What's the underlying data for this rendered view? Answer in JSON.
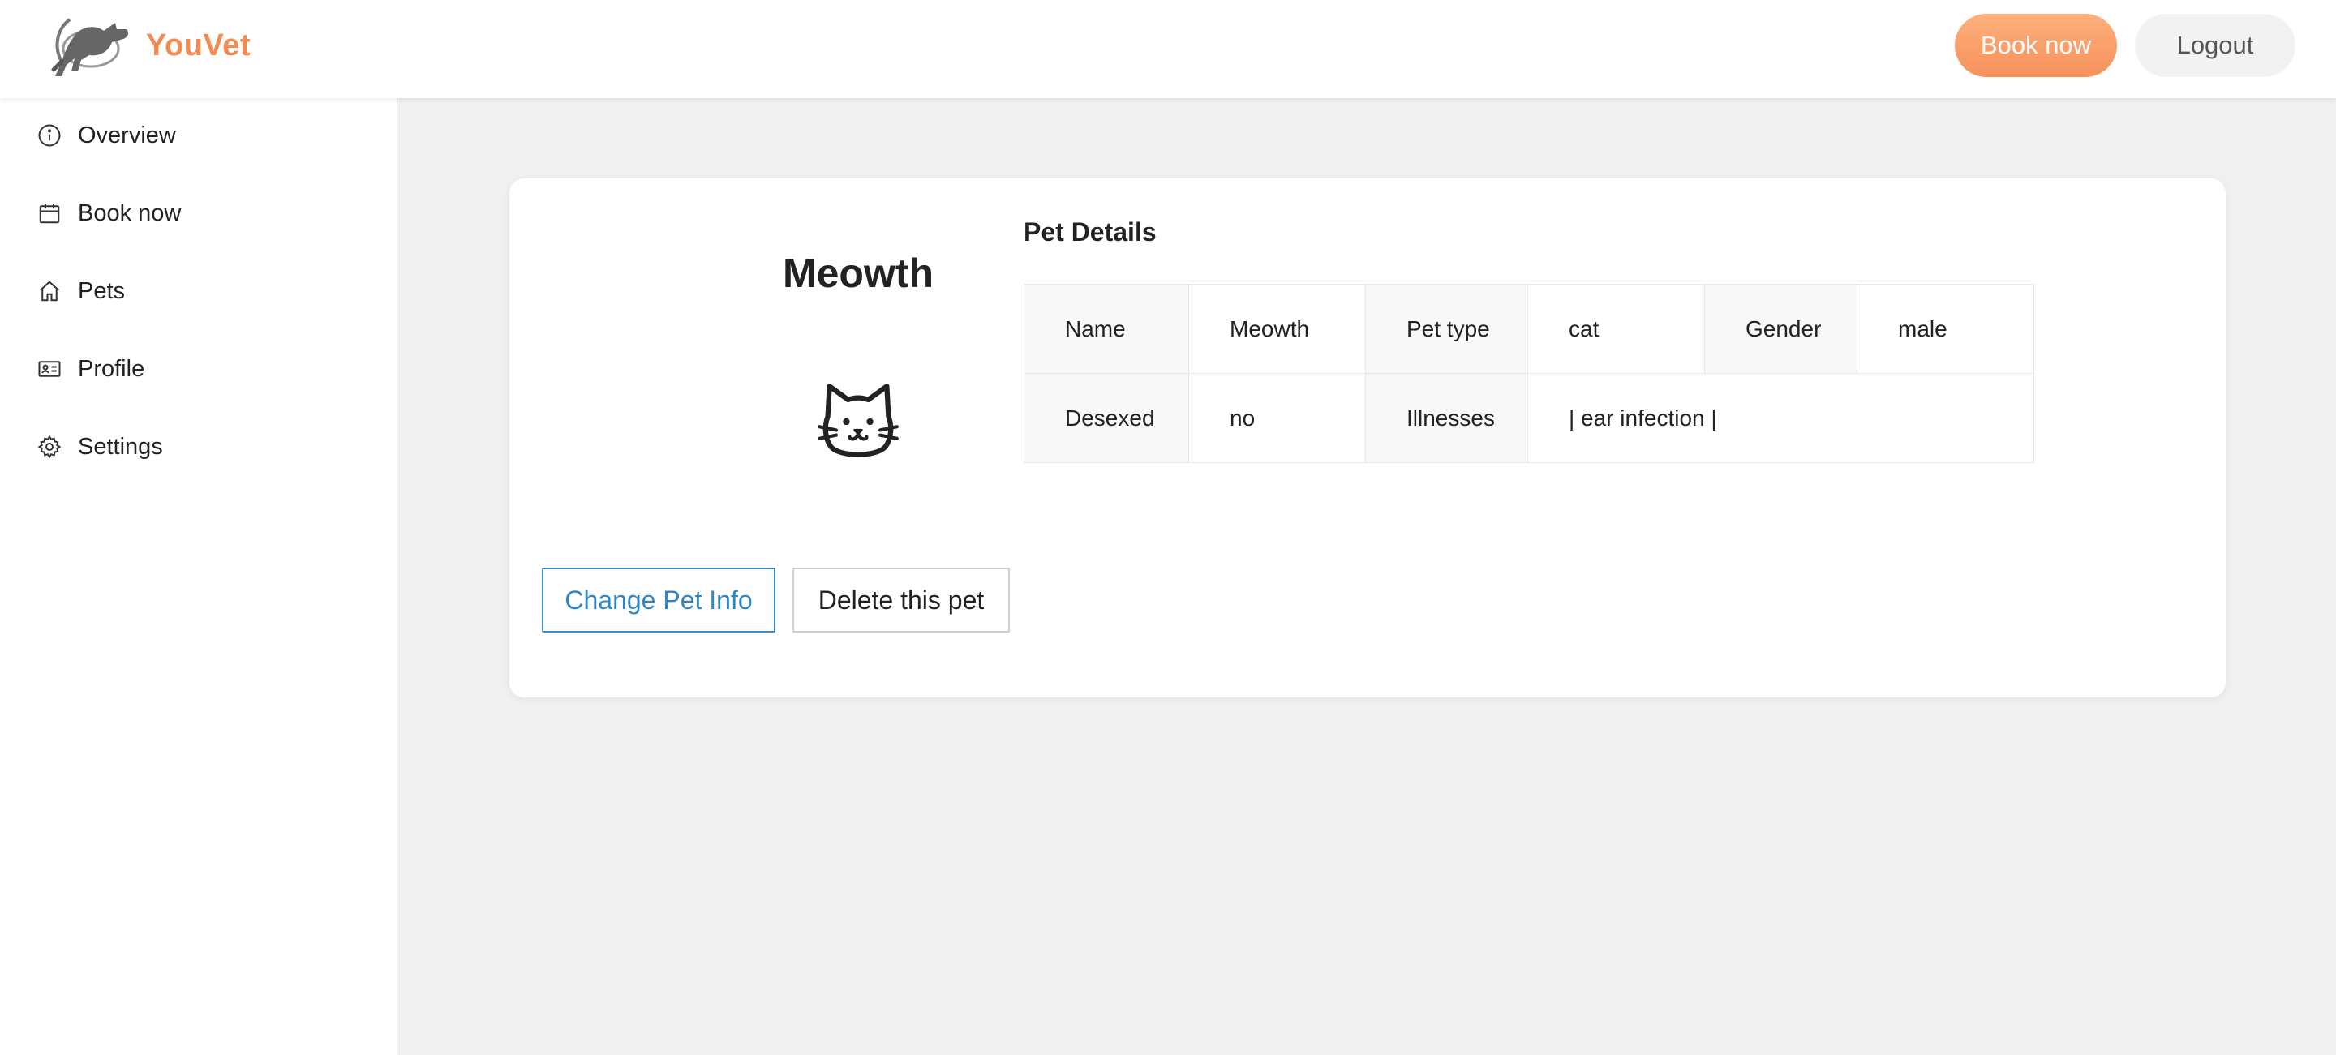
{
  "header": {
    "logo_text": "YouVet",
    "book_label": "Book now",
    "logout_label": "Logout"
  },
  "sidebar": {
    "items": [
      {
        "label": "Overview",
        "icon": "info-circle-icon"
      },
      {
        "label": "Book now",
        "icon": "calendar-icon"
      },
      {
        "label": "Pets",
        "icon": "home-icon"
      },
      {
        "label": "Profile",
        "icon": "id-card-icon"
      },
      {
        "label": "Settings",
        "icon": "gear-icon"
      }
    ]
  },
  "pet": {
    "name": "Meowth",
    "icon": "cat-face-icon",
    "details_title": "Pet Details",
    "details": {
      "name_label": "Name",
      "name_value": "Meowth",
      "type_label": "Pet type",
      "type_value": "cat",
      "gender_label": "Gender",
      "gender_value": "male",
      "desexed_label": "Desexed",
      "desexed_value": "no",
      "illnesses_label": "Illnesses",
      "illnesses_value": "| ear infection |"
    },
    "change_label": "Change Pet Info",
    "delete_label": "Delete this pet"
  },
  "colors": {
    "accent": "#f5915c",
    "link_blue": "#2f86c5",
    "background": "#f0f0f0"
  }
}
